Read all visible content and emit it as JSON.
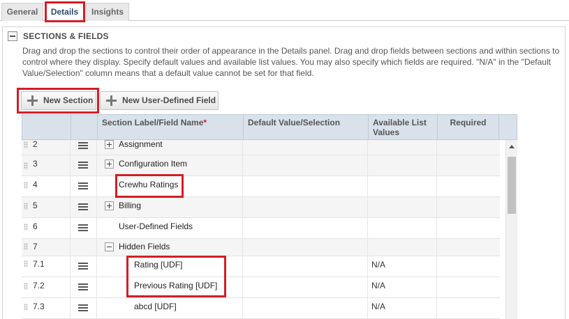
{
  "tabs": [
    {
      "label": "General",
      "active": false
    },
    {
      "label": "Details",
      "active": true
    },
    {
      "label": "Insights",
      "active": false
    }
  ],
  "section": {
    "title": "SECTIONS & FIELDS",
    "description": "Drag and drop the sections to control their order of appearance in the Details panel. Drag and drop fields between sections and within sections to control where they display. Specify default values and available list values. You may also specify which fields are required. \"N/A\" in the \"Default Value/Selection\" column means that a default value cannot be set for that field."
  },
  "buttons": {
    "new_section": "New Section",
    "new_udf": "New User-Defined Field"
  },
  "grid": {
    "headers": {
      "section_label": "Section Label/Field Name",
      "required_marker": "*",
      "default_value": "Default Value/Selection",
      "available_list": "Available List Values",
      "required": "Required"
    },
    "rows": [
      {
        "num": "2",
        "name": "Assignment",
        "expander": "plus",
        "available": ""
      },
      {
        "num": "3",
        "name": "Configuration Item",
        "expander": "plus",
        "available": ""
      },
      {
        "num": "4",
        "name": "Crewhu Ratings",
        "expander": "none",
        "available": ""
      },
      {
        "num": "5",
        "name": "Billing",
        "expander": "plus",
        "available": ""
      },
      {
        "num": "6",
        "name": "User-Defined Fields",
        "expander": "none",
        "available": ""
      },
      {
        "num": "7",
        "name": "Hidden Fields",
        "expander": "minus",
        "available": ""
      },
      {
        "num": "7.1",
        "name": "Rating [UDF]",
        "expander": "none",
        "available": "N/A"
      },
      {
        "num": "7.2",
        "name": "Previous Rating [UDF]",
        "expander": "none",
        "available": "N/A"
      },
      {
        "num": "7.3",
        "name": "abcd [UDF]",
        "expander": "none",
        "available": "N/A"
      }
    ]
  },
  "colors": {
    "highlight": "#d31e25",
    "header_bg": "#d9e1eb",
    "active_tab_text": "#2a4d73"
  }
}
